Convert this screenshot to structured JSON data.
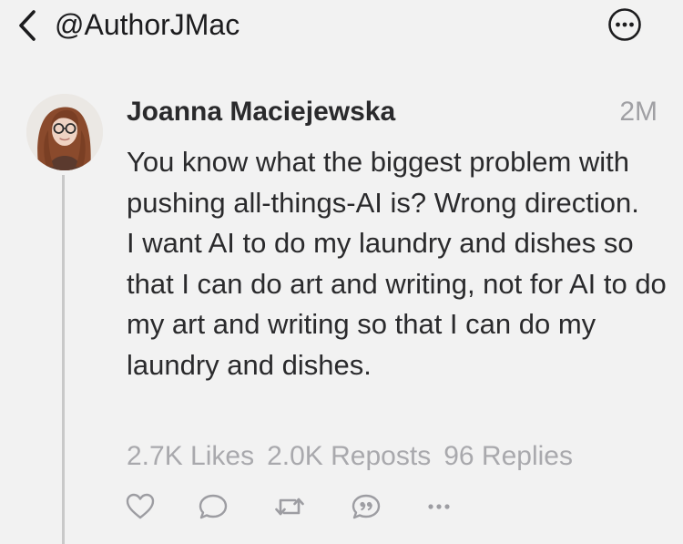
{
  "header": {
    "handle": "@AuthorJMac",
    "back_icon": "chevron-left-icon",
    "more_icon": "ellipsis-circle-icon"
  },
  "post": {
    "author": "Joanna Maciejewska",
    "time": "2M",
    "paragraph_1": "You know what the biggest problem with pushing all-things-AI is? Wrong direction.",
    "paragraph_2": "I want AI to do my laundry and dishes so that I can do art and writing, not for AI to do my art and writing so that I can do my laundry and dishes.",
    "stats": {
      "likes": "2.7K Likes",
      "reposts": "2.0K Reposts",
      "replies": "96 Replies"
    },
    "actions": [
      "heart-icon",
      "reply-icon",
      "repost-icon",
      "quote-icon",
      "more-horizontal-icon"
    ]
  },
  "colors": {
    "background": "#f2f2f2",
    "text": "#2a2a2c",
    "muted": "#a9a9ad"
  }
}
